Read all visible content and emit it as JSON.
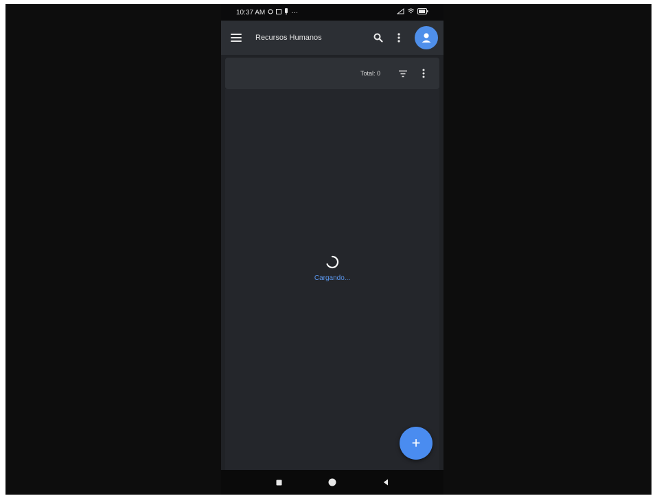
{
  "status_bar": {
    "time": "10:37 AM",
    "left_icons": [
      "location-icon",
      "image-icon",
      "notification-icon"
    ],
    "overflow": "···",
    "right_icons": [
      "signal-icon",
      "wifi-icon",
      "battery-icon"
    ]
  },
  "app_bar": {
    "title": "Recursos Humanos",
    "icons": [
      "menu-icon",
      "search-icon",
      "more-vert-icon",
      "account-icon"
    ]
  },
  "toolbar": {
    "total_label": "Total: 0",
    "icons": [
      "filter-icon",
      "more-vert-icon"
    ]
  },
  "content": {
    "loading_text": "Cargando..."
  },
  "fab": {
    "label": "+",
    "icon": "add-icon"
  },
  "nav_bar": {
    "icons": [
      "recents-icon",
      "home-icon",
      "back-icon"
    ]
  },
  "colors": {
    "accent": "#4a8cf0",
    "app_bar": "#2c2f34",
    "background": "#24262b",
    "loading_text": "#5b97ee"
  }
}
